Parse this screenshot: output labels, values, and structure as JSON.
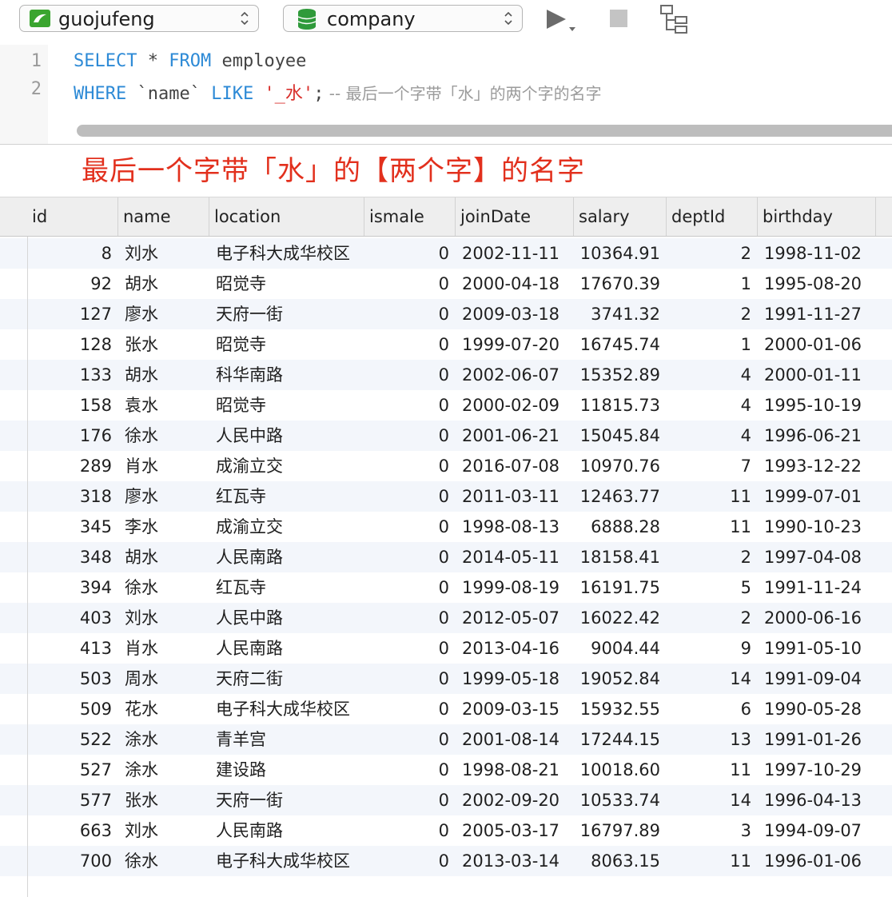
{
  "toolbar": {
    "connection": "guojufeng",
    "database": "company",
    "run_icon": "play-icon",
    "stop_icon": "stop-icon",
    "schema_icon": "schema-tree-icon",
    "conn_color": "#3aa52f",
    "db_color": "#2f9a3a"
  },
  "editor": {
    "line_numbers": [
      "1",
      "2"
    ],
    "line1": {
      "kw1": "SELECT",
      "mid1": " * ",
      "kw2": "FROM",
      "rest": " employee"
    },
    "line2": {
      "kw1": "WHERE",
      "mid1": " `name` ",
      "kw2": "LIKE",
      "sp": " ",
      "str": "'_水'",
      "semi": ";",
      "comment": " -- 最后一个字带「水」的两个字的名字"
    }
  },
  "annotation": "最后一个字带「水」的【两个字】的名字",
  "table": {
    "columns": [
      "id",
      "name",
      "location",
      "ismale",
      "joinDate",
      "salary",
      "deptId",
      "birthday"
    ],
    "rows": [
      [
        "8",
        "刘水",
        "电子科大成华校区",
        "0",
        "2002-11-11",
        "10364.91",
        "2",
        "1998-11-02"
      ],
      [
        "92",
        "胡水",
        "昭觉寺",
        "0",
        "2000-04-18",
        "17670.39",
        "1",
        "1995-08-20"
      ],
      [
        "127",
        "廖水",
        "天府一街",
        "0",
        "2009-03-18",
        "3741.32",
        "2",
        "1991-11-27"
      ],
      [
        "128",
        "张水",
        "昭觉寺",
        "0",
        "1999-07-20",
        "16745.74",
        "1",
        "2000-01-06"
      ],
      [
        "133",
        "胡水",
        "科华南路",
        "0",
        "2002-06-07",
        "15352.89",
        "4",
        "2000-01-11"
      ],
      [
        "158",
        "袁水",
        "昭觉寺",
        "0",
        "2000-02-09",
        "11815.73",
        "4",
        "1995-10-19"
      ],
      [
        "176",
        "徐水",
        "人民中路",
        "0",
        "2001-06-21",
        "15045.84",
        "4",
        "1996-06-21"
      ],
      [
        "289",
        "肖水",
        "成渝立交",
        "0",
        "2016-07-08",
        "10970.76",
        "7",
        "1993-12-22"
      ],
      [
        "318",
        "廖水",
        "红瓦寺",
        "0",
        "2011-03-11",
        "12463.77",
        "11",
        "1999-07-01"
      ],
      [
        "345",
        "李水",
        "成渝立交",
        "0",
        "1998-08-13",
        "6888.28",
        "11",
        "1990-10-23"
      ],
      [
        "348",
        "胡水",
        "人民南路",
        "0",
        "2014-05-11",
        "18158.41",
        "2",
        "1997-04-08"
      ],
      [
        "394",
        "徐水",
        "红瓦寺",
        "0",
        "1999-08-19",
        "16191.75",
        "5",
        "1991-11-24"
      ],
      [
        "403",
        "刘水",
        "人民中路",
        "0",
        "2012-05-07",
        "16022.42",
        "2",
        "2000-06-16"
      ],
      [
        "413",
        "肖水",
        "人民南路",
        "0",
        "2013-04-16",
        "9004.44",
        "9",
        "1991-05-10"
      ],
      [
        "503",
        "周水",
        "天府二街",
        "0",
        "1999-05-18",
        "19052.84",
        "14",
        "1991-09-04"
      ],
      [
        "509",
        "花水",
        "电子科大成华校区",
        "0",
        "2009-03-15",
        "15932.55",
        "6",
        "1990-05-28"
      ],
      [
        "522",
        "涂水",
        "青羊宫",
        "0",
        "2001-08-14",
        "17244.15",
        "13",
        "1991-01-26"
      ],
      [
        "527",
        "涂水",
        "建设路",
        "0",
        "1998-08-21",
        "10018.60",
        "11",
        "1997-10-29"
      ],
      [
        "577",
        "张水",
        "天府一街",
        "0",
        "2002-09-20",
        "10533.74",
        "14",
        "1996-04-13"
      ],
      [
        "663",
        "刘水",
        "人民南路",
        "0",
        "2005-03-17",
        "16797.89",
        "3",
        "1994-09-07"
      ],
      [
        "700",
        "徐水",
        "电子科大成华校区",
        "0",
        "2013-03-14",
        "8063.15",
        "11",
        "1996-01-06"
      ]
    ]
  }
}
